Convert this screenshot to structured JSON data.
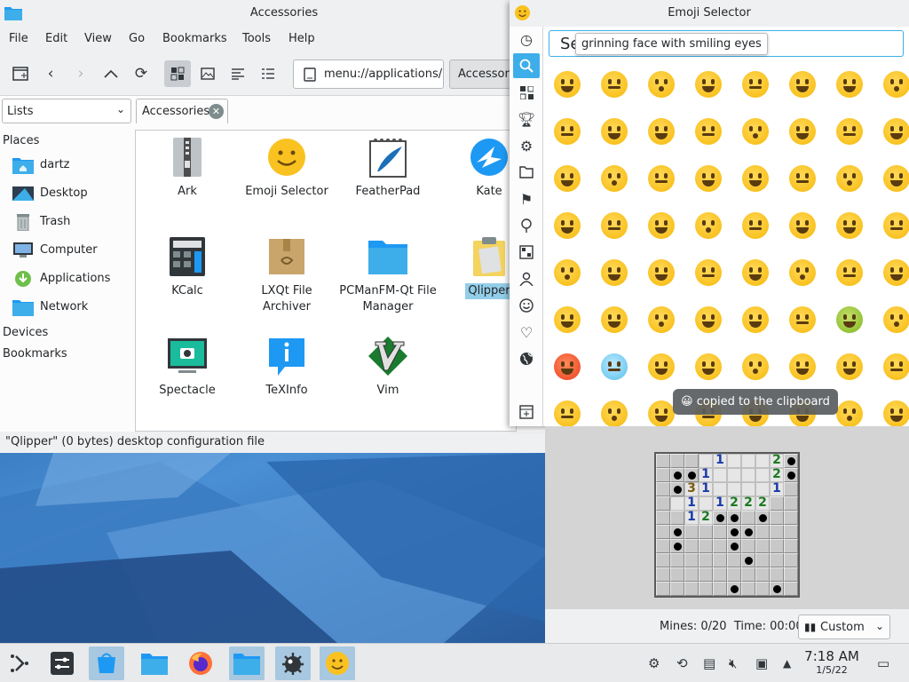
{
  "accessories": {
    "title": "Accessories",
    "menu": [
      "File",
      "Edit",
      "View",
      "Go",
      "Bookmarks",
      "Tools",
      "Help"
    ],
    "address": "menu://applications/",
    "breadcrumb": "Accessories",
    "lists_select": "Lists",
    "tab_label": "Accessories",
    "places_header": "Places",
    "places": [
      "dartz",
      "Desktop",
      "Trash",
      "Computer",
      "Applications",
      "Network"
    ],
    "devices_header": "Devices",
    "bookmarks_header": "Bookmarks",
    "files": [
      "Ark",
      "Emoji Selector",
      "FeatherPad",
      "Kate",
      "KCalc",
      "LXQt File Archiver",
      "PCManFM-Qt File Manager",
      "Qlipper",
      "Spectacle",
      "TeXInfo",
      "Vim"
    ],
    "status": "\"Qlipper\" (0 bytes) desktop configuration file",
    "colors": {
      "selection": "#93cee9",
      "folder": "#3daee9"
    }
  },
  "emoji": {
    "title": "Emoji Selector",
    "search_value": "Se",
    "tooltip": "grinning face with smiling eyes",
    "toast": "copied to the clipboard",
    "toast_emoji": "😀",
    "categories": [
      "clock-icon",
      "search-icon",
      "grid-icon",
      "trophy-icon",
      "compass-icon",
      "folder-icon",
      "flag-icon",
      "pin-icon",
      "symbols-icon",
      "person-icon",
      "smiley-icon",
      "heart-icon",
      "globe-icon",
      "add-panel-icon"
    ],
    "accent": "#3daee9"
  },
  "minesweeper": {
    "mines_label": "Mines: 0/20",
    "time_label": "Time: 00:00",
    "difficulty": "Custom"
  },
  "taskbar": {
    "time": "7:18 AM",
    "date": "1/5/22"
  }
}
